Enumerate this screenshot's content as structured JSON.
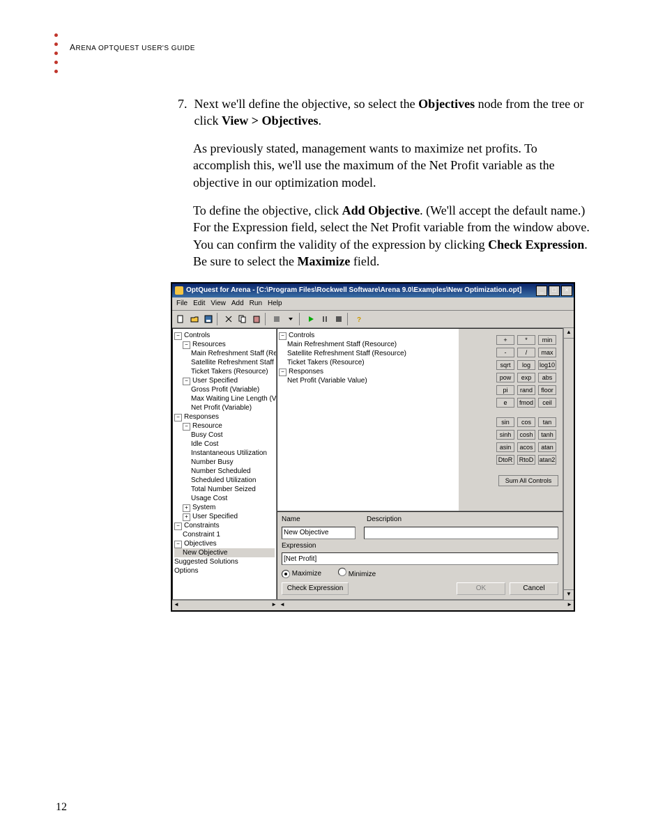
{
  "doc": {
    "header_prefix": "A",
    "header_rest": "RENA OPTQUEST USER'S GUIDE",
    "page_number": "12",
    "step_num": "7.",
    "step_text_1": "Next we'll define the objective, so select the ",
    "step_bold_1": "Objectives",
    "step_text_2": " node from the tree or click ",
    "step_bold_2": "View > Objectives",
    "step_text_3": ".",
    "para2": "As previously stated, management wants to maximize net profits. To accomplish this, we'll use the maximum of the Net Profit variable as the objective in our optimization model.",
    "p3_a": "To define the objective, click ",
    "p3_b": "Add Objective",
    "p3_c": ". (We'll accept the default name.) For the Expression field, select the Net Profit variable from the window above. You can confirm the validity of the expression by clicking ",
    "p3_d": "Check Expression",
    "p3_e": ". Be sure to select the ",
    "p3_f": "Maximize",
    "p3_g": " field."
  },
  "app": {
    "title": "OptQuest for Arena - [C:\\Program Files\\Rockwell Software\\Arena 9.0\\Examples\\New Optimization.opt]",
    "menu": [
      "File",
      "Edit",
      "View",
      "Add",
      "Run",
      "Help"
    ],
    "left_tree": {
      "controls": "Controls",
      "resources": "Resources",
      "res_items": [
        "Main Refreshment Staff (Res",
        "Satellite Refreshment Staff (",
        "Ticket Takers (Resource)"
      ],
      "user_spec": "User Specified",
      "us_items": [
        "Gross Profit (Variable)",
        "Max Waiting Line Length (Va",
        "Net Profit (Variable)"
      ],
      "responses": "Responses",
      "resource": "Resource",
      "resource_items": [
        "Busy Cost",
        "Idle Cost",
        "Instantaneous Utilization",
        "Number Busy",
        "Number Scheduled",
        "Scheduled Utilization",
        "Total Number Seized",
        "Usage Cost"
      ],
      "system": "System",
      "user_spec2": "User Specified",
      "constraints": "Constraints",
      "constraint1": "Constraint 1",
      "objectives": "Objectives",
      "new_objective": "New Objective",
      "suggested": "Suggested Solutions",
      "options": "Options"
    },
    "right_tree": {
      "controls": "Controls",
      "c_items": [
        "Main Refreshment Staff (Resource)",
        "Satellite Refreshment Staff (Resource)",
        "Ticket Takers (Resource)"
      ],
      "responses": "Responses",
      "r_items": [
        "Net Profit (Variable Value)"
      ]
    },
    "calc": [
      [
        "+",
        "*",
        "min"
      ],
      [
        "-",
        "/",
        "max"
      ],
      [
        "sqrt",
        "log",
        "log10"
      ],
      [
        "pow",
        "exp",
        "abs"
      ],
      [
        "pi",
        "rand",
        "floor"
      ],
      [
        "e",
        "fmod",
        "ceil"
      ],
      [
        "sin",
        "cos",
        "tan"
      ],
      [
        "sinh",
        "cosh",
        "tanh"
      ],
      [
        "asin",
        "acos",
        "atan"
      ],
      [
        "DtoR",
        "RtoD",
        "atan2"
      ]
    ],
    "sum_all": "Sum All Controls",
    "form": {
      "name_lbl": "Name",
      "desc_lbl": "Description",
      "name_val": "New Objective",
      "desc_val": "",
      "expr_lbl": "Expression",
      "expr_val": "[Net Profit]",
      "maximize": "Maximize",
      "minimize": "Minimize",
      "check": "Check Expression",
      "ok": "OK",
      "cancel": "Cancel"
    }
  }
}
